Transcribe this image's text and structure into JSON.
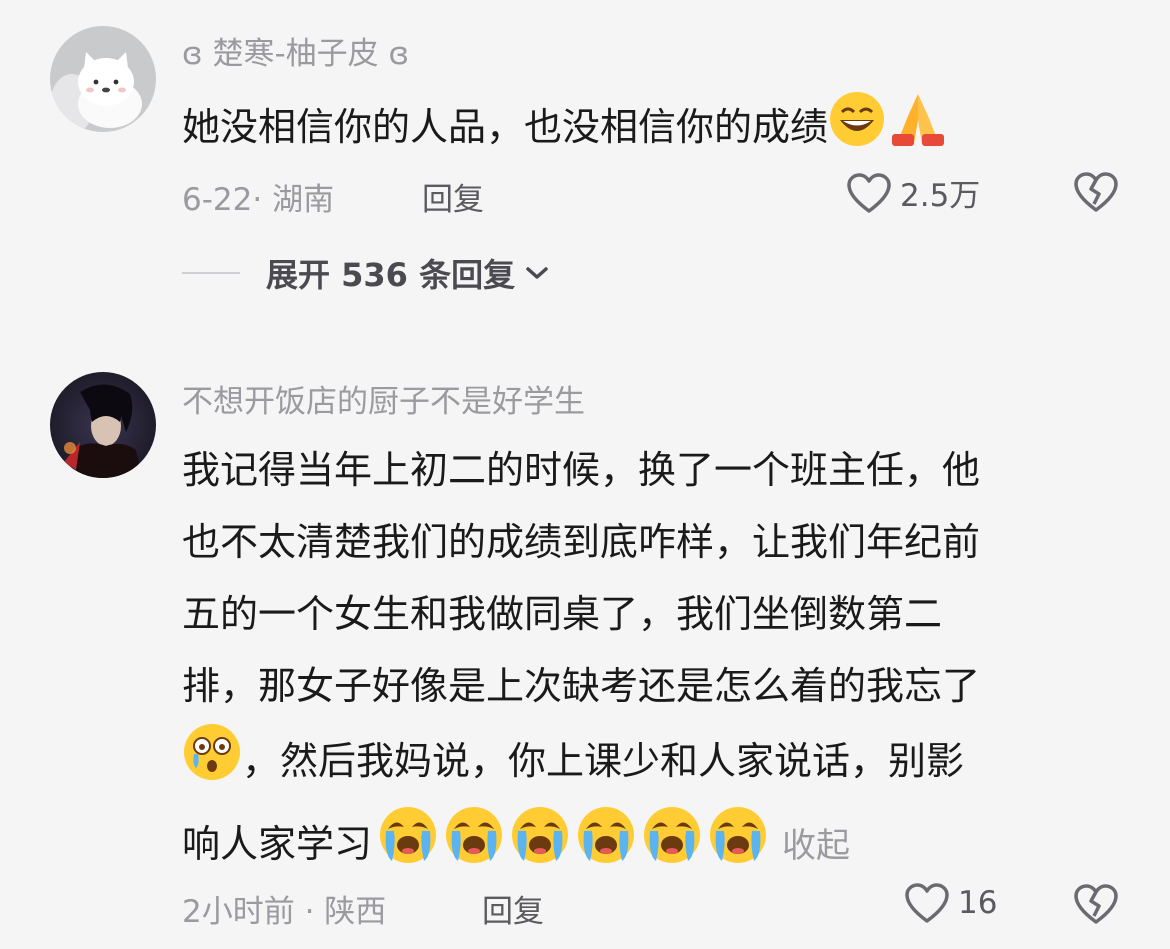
{
  "comments": [
    {
      "username": "ɞ 楚寒-柚子皮 ɞ",
      "text": "她没相信你的人品，也没相信你的成绩",
      "emojis": [
        "grin-emoji",
        "pray-emoji"
      ],
      "date_location": "6-22· 湖南",
      "reply_label": "回复",
      "likes": "2.5万",
      "expand_label": "展开 536 条回复"
    },
    {
      "username": "不想开饭店的厨子不是好学生",
      "lines": [
        "我记得当年上初二的时候，换了一个班主任，他",
        "也不太清楚我们的成绩到底咋样，让我们年纪前",
        "五的一个女生和我做同桌了，我们坐倒数第二",
        "排，那女子好像是上次缺考还是怎么着的我忘了",
        "，然后我妈说，你上课少和人家说话，别影",
        "响人家学习"
      ],
      "collapse_label": "收起",
      "date_location": "2小时前 · 陕西",
      "reply_label": "回复",
      "likes": "16"
    }
  ],
  "colors": {
    "background": "#f5f5f5",
    "text": "#1a1a1a",
    "muted": "#9a9aa0"
  }
}
